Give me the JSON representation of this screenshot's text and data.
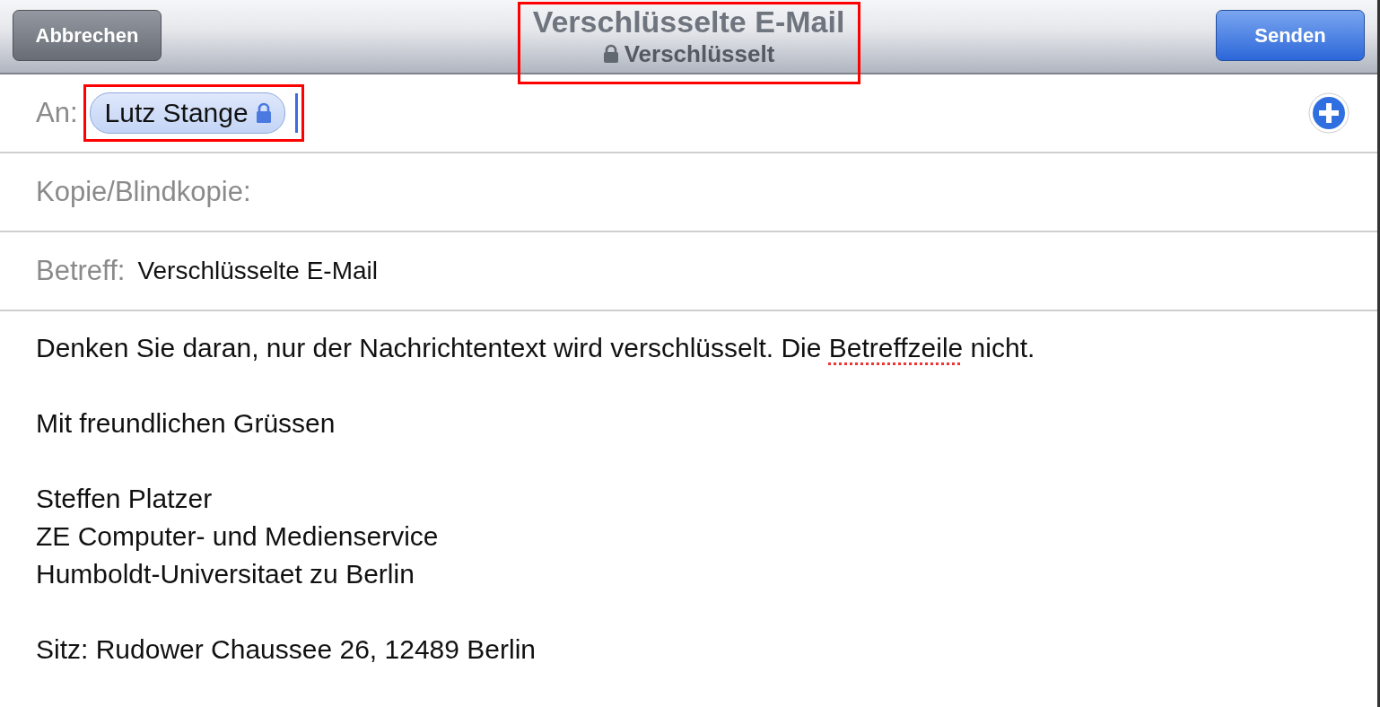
{
  "header": {
    "cancel": "Abbrechen",
    "title": "Verschlüsselte E-Mail",
    "subtitle": "Verschlüsselt",
    "send": "Senden",
    "highlighted": true
  },
  "to": {
    "label": "An:",
    "recipient": "Lutz Stange",
    "encrypted": true,
    "highlighted": true
  },
  "cc": {
    "label": "Kopie/Blindkopie:"
  },
  "subject": {
    "label": "Betreff:",
    "value": "Verschlüsselte E-Mail"
  },
  "body": [
    [
      [
        {
          "text": "Denken Sie daran, nur der Nachrichtentext wird verschlüsselt. Die ",
          "misspelled": false
        },
        {
          "text": "Betreffzeile",
          "misspelled": true
        },
        {
          "text": " nicht.",
          "misspelled": false
        }
      ]
    ],
    [
      [
        {
          "text": "Mit freundlichen Grüssen",
          "misspelled": false
        }
      ]
    ],
    [
      [
        {
          "text": "Steffen Platzer",
          "misspelled": false
        }
      ],
      [
        {
          "text": "ZE Computer- und Medienservice",
          "misspelled": false
        }
      ],
      [
        {
          "text": "Humboldt-Universitaet zu Berlin",
          "misspelled": false
        }
      ]
    ],
    [
      [
        {
          "text": "Sitz: Rudower Chaussee 26, 12489 Berlin",
          "misspelled": false
        }
      ]
    ]
  ]
}
